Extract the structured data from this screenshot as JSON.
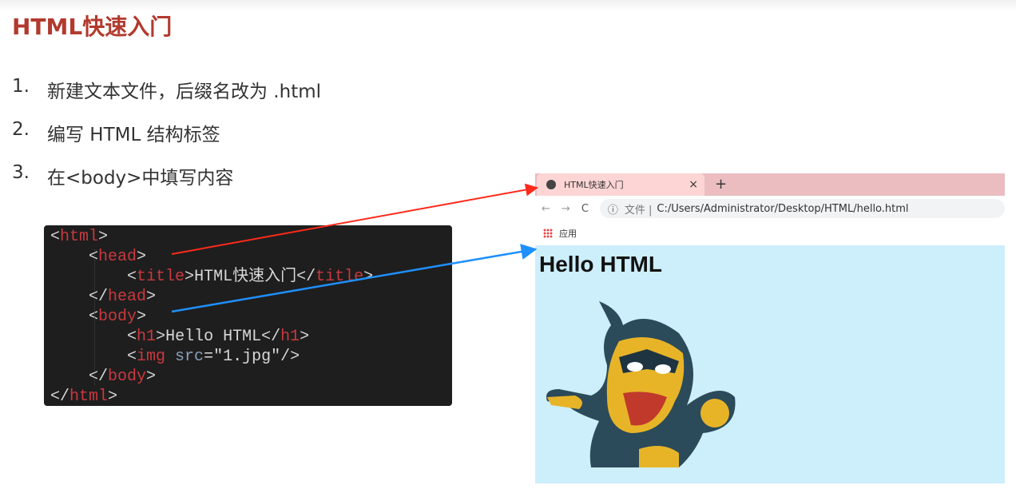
{
  "title": "HTML快速入门",
  "steps": [
    {
      "num": "1.",
      "text": "新建文本文件，后缀名改为 .html"
    },
    {
      "num": "2.",
      "text": "编写 HTML 结构标签"
    },
    {
      "num": "3.",
      "text": "在<body>中填写内容"
    }
  ],
  "code": {
    "l1": [
      "<",
      "html",
      ">"
    ],
    "l2": [
      "<",
      "head",
      ">"
    ],
    "l3": [
      "<",
      "title",
      ">",
      "HTML快速入门",
      "</",
      "title",
      ">"
    ],
    "l4": [
      "</",
      "head",
      ">"
    ],
    "l5": [
      "<",
      "body",
      ">"
    ],
    "l6": [
      "<",
      "h1",
      ">",
      "Hello HTML",
      "</",
      "h1",
      ">"
    ],
    "l7": [
      "<",
      "img",
      " src",
      "=\"1.jpg\"/>"
    ],
    "l8": [
      "</",
      "body",
      ">"
    ],
    "l9": [
      "</",
      "html",
      ">"
    ]
  },
  "browser": {
    "tab_title": "HTML快速入门",
    "close": "×",
    "new_tab": "+",
    "back": "←",
    "forward": "→",
    "reload": "C",
    "info": "ⓘ",
    "file_label": "文件 |",
    "url": "C:/Users/Administrator/Desktop/HTML/hello.html",
    "bookmark_apps": "应用",
    "heading": "Hello HTML"
  },
  "colors": {
    "title": "#b23a2e",
    "arrow_head": "#ff2a1a",
    "arrow_body": "#1e90ff",
    "page_bg": "#cdeefb"
  }
}
